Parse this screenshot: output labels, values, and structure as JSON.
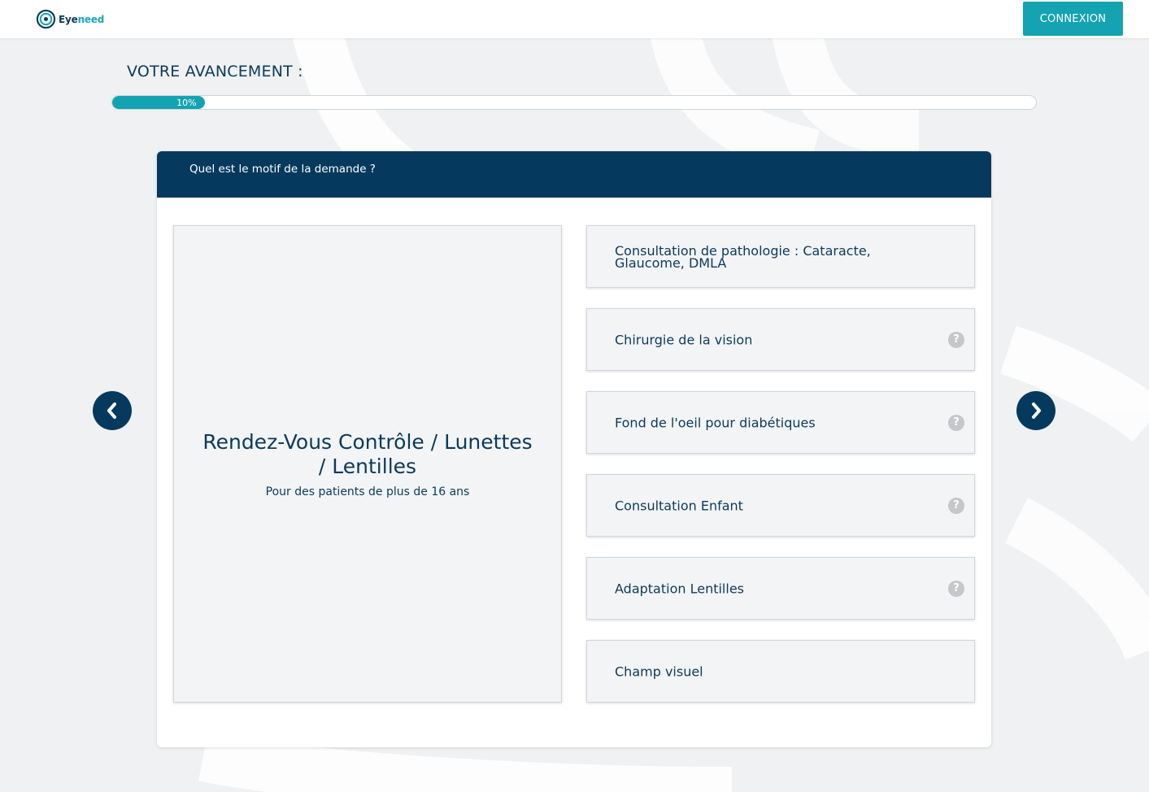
{
  "brand": {
    "name_part1": "Eye",
    "name_part2": "need",
    "accent_color": "#14a3b3",
    "navy_color": "#053a5e"
  },
  "header": {
    "login_label": "CONNEXION"
  },
  "progress": {
    "title": "VOTRE AVANCEMENT :",
    "percent": 10,
    "label": "10%"
  },
  "question": {
    "text": "Quel est le motif de la demande ?"
  },
  "featured_option": {
    "title": "Rendez-Vous Contrôle / Lunettes / Lentilles",
    "subtitle": "Pour des patients de plus de 16 ans"
  },
  "options": [
    {
      "label": "Consultation de pathologie : Cataracte, Glaucome, DMLA",
      "has_help": false
    },
    {
      "label": "Chirurgie de la vision",
      "has_help": true
    },
    {
      "label": "Fond de l'oeil pour diabétiques",
      "has_help": true
    },
    {
      "label": "Consultation Enfant",
      "has_help": true
    },
    {
      "label": "Adaptation Lentilles",
      "has_help": true
    },
    {
      "label": "Champ visuel",
      "has_help": false
    }
  ],
  "help_icon": {
    "glyph": "?",
    "icon": "question-circle-icon"
  },
  "navigation": {
    "prev_icon": "chevron-left-icon",
    "next_icon": "chevron-right-icon"
  }
}
